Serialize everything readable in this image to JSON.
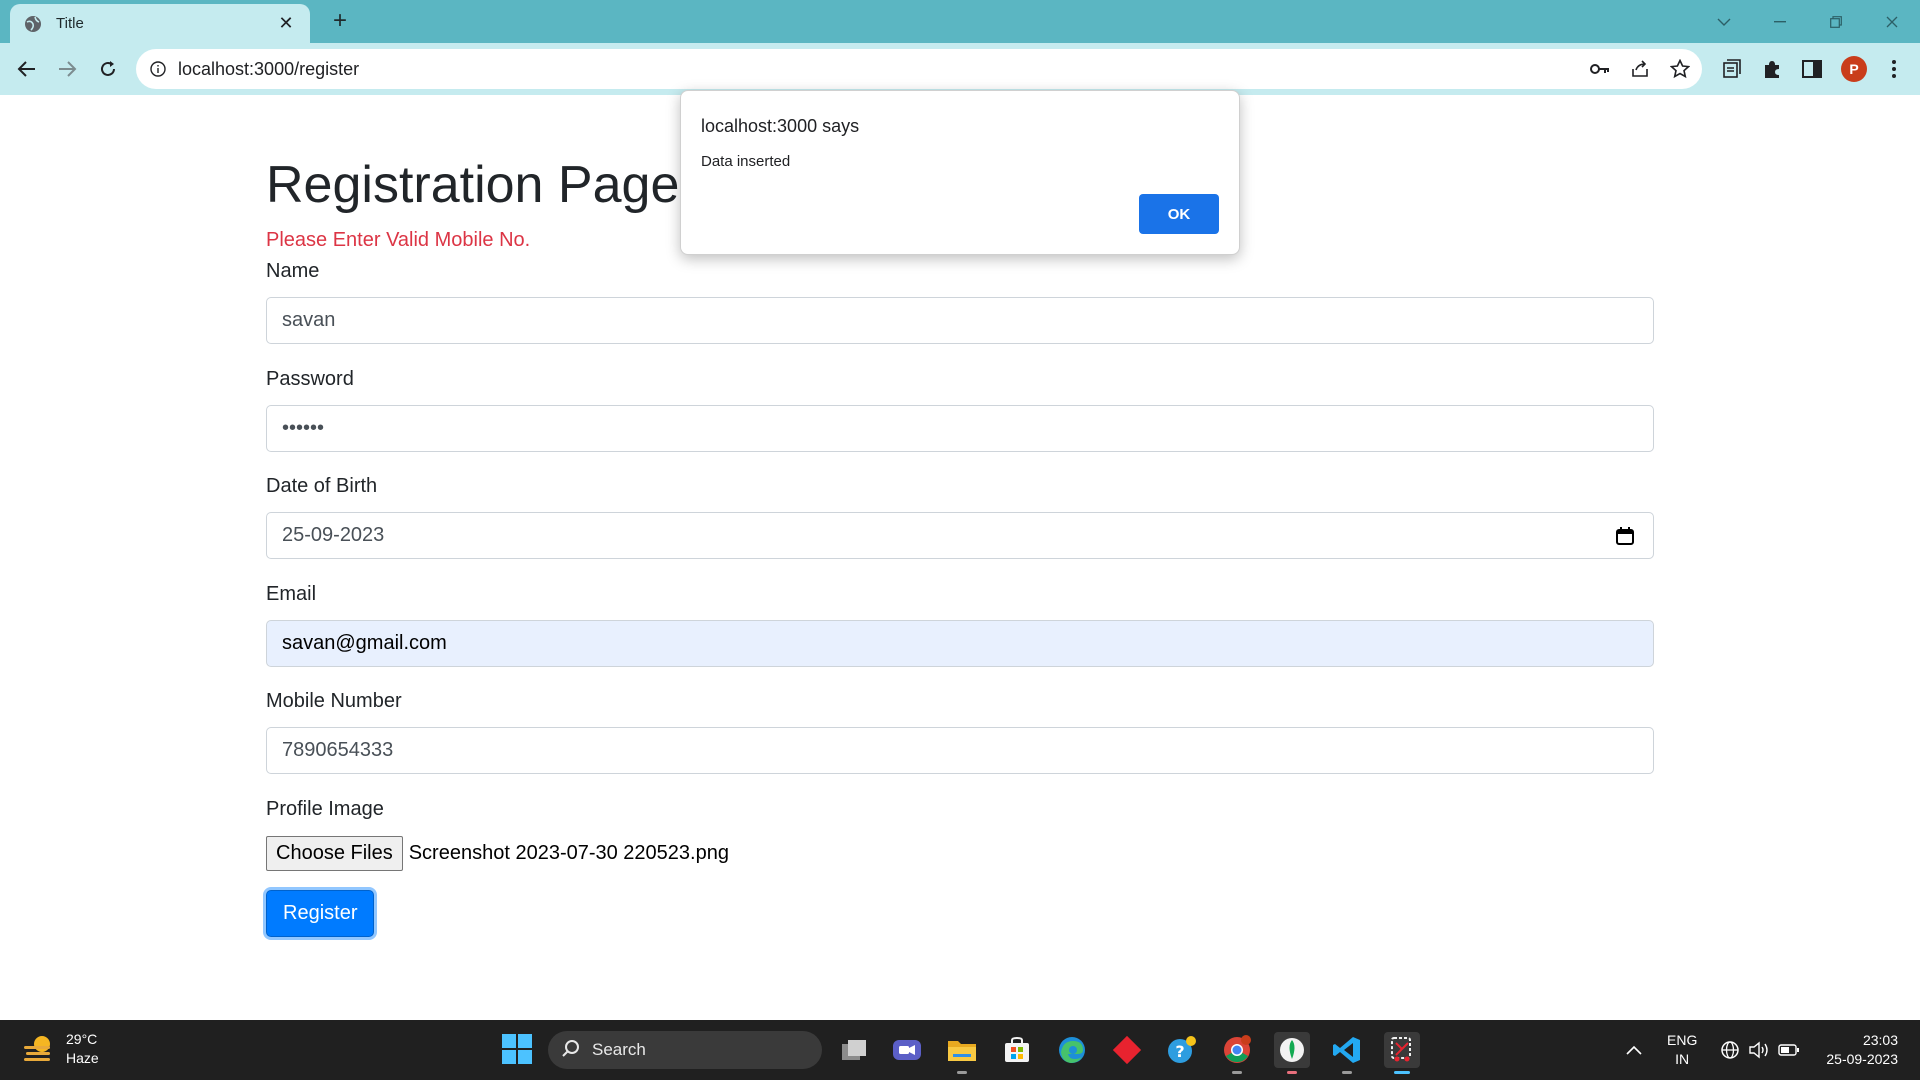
{
  "browser": {
    "tab_title": "Title",
    "new_tab": "+",
    "url": "localhost:3000/register",
    "profile_initial": "P",
    "accent_color": "#5bb6c2"
  },
  "page": {
    "title": "Registration Page",
    "error": "Please Enter Valid Mobile No.",
    "fields": {
      "name": {
        "label": "Name",
        "value": "savan"
      },
      "password": {
        "label": "Password",
        "value": "••••••"
      },
      "dob": {
        "label": "Date of Birth",
        "value": "25-09-2023"
      },
      "email": {
        "label": "Email",
        "value": "savan@gmail.com"
      },
      "mobile": {
        "label": "Mobile Number",
        "value": "7890654333"
      },
      "profile_image": {
        "label": "Profile Image",
        "button": "Choose Files",
        "file_name": "Screenshot 2023-07-30 220523.png"
      }
    },
    "register_button": "Register",
    "error_color": "#dc3545",
    "primary_color": "#007bff"
  },
  "dialog": {
    "title": "localhost:3000 says",
    "message": "Data inserted",
    "ok_label": "OK"
  },
  "taskbar": {
    "weather_temp": "29°C",
    "weather_desc": "Haze",
    "search_label": "Search",
    "language": "ENG",
    "region": "IN",
    "time": "23:03",
    "date": "25-09-2023"
  }
}
